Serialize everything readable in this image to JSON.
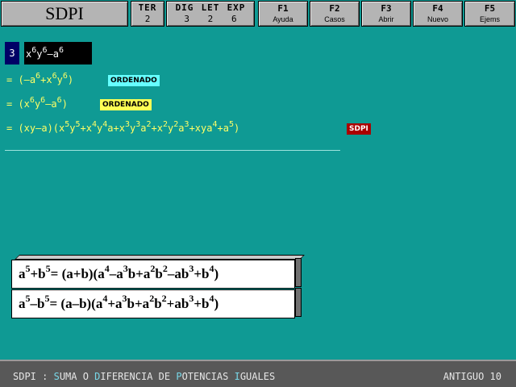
{
  "app": {
    "title": "SDPI"
  },
  "stats": {
    "ter_label": "TER",
    "ter_value": "2",
    "dig_label": "DIG",
    "dig_value": "3",
    "let_label": "LET",
    "let_value": "2",
    "exp_label": "EXP",
    "exp_value": "6"
  },
  "fkeys": [
    {
      "key": "F1",
      "label": "Ayuda"
    },
    {
      "key": "F2",
      "label": "Casos"
    },
    {
      "key": "F3",
      "label": "Abrir"
    },
    {
      "key": "F4",
      "label": "Nuevo"
    },
    {
      "key": "F5",
      "label": "Ejems"
    }
  ],
  "work": {
    "step_number": "3",
    "badges": {
      "ordenado1": "ORDENADO",
      "ordenado2": "ORDENADO",
      "sdpi": "SDPI"
    },
    "badge_colors": {
      "ordenado1": "#66ffff",
      "ordenado2": "#ffff55",
      "sdpi": "#aa0000"
    }
  },
  "status": {
    "prefix": "SDPI : ",
    "words": [
      {
        "initial": "S",
        "rest": "UMA O "
      },
      {
        "initial": "D",
        "rest": "IFERENCIA DE "
      },
      {
        "initial": "P",
        "rest": "OTENCIAS "
      },
      {
        "initial": "I",
        "rest": "GUALES"
      }
    ],
    "right": "ANTIGUO 10"
  }
}
